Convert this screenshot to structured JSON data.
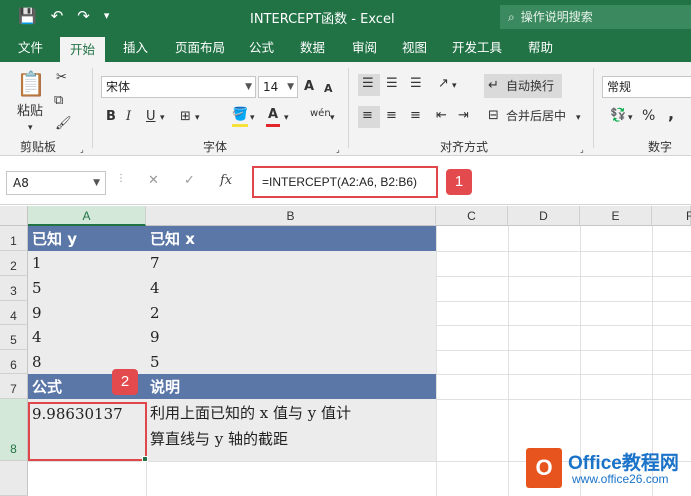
{
  "title_bar": {
    "title": "INTERCEPT函数  -  Excel",
    "search_placeholder": "操作说明搜索",
    "qat": {
      "save": "💾",
      "undo": "↶",
      "redo": "↷",
      "customize": "▾"
    }
  },
  "tabs": [
    "文件",
    "开始",
    "插入",
    "页面布局",
    "公式",
    "数据",
    "审阅",
    "视图",
    "开发工具",
    "帮助"
  ],
  "active_tab": "开始",
  "ribbon": {
    "clipboard": {
      "paste_label": "粘贴",
      "group_label": "剪贴板"
    },
    "font": {
      "font_name": "宋体",
      "font_size": "14",
      "group_label": "字体",
      "bold": "B",
      "italic": "I",
      "underline": "U",
      "grow": "A",
      "shrink": "A",
      "font_color": "A",
      "wen": "wén"
    },
    "alignment": {
      "wrap_text": "自动换行",
      "merge_center": "合并后居中",
      "group_label": "对齐方式"
    },
    "number": {
      "format": "常规",
      "percent": "%",
      "comma": ",",
      "group_label": "数字"
    }
  },
  "formula_bar": {
    "name_box": "A8",
    "cancel": "✕",
    "enter": "✓",
    "fx": "fx",
    "formula": "=INTERCEPT(A2:A6, B2:B6)"
  },
  "callouts": {
    "one": "1",
    "two": "2"
  },
  "grid": {
    "columns": [
      "A",
      "B",
      "C",
      "D",
      "E",
      "F"
    ],
    "rows": [
      "1",
      "2",
      "3",
      "4",
      "5",
      "6",
      "7",
      "8"
    ],
    "cells": {
      "A1": "已知 y",
      "B1": "已知 x",
      "A2": "1",
      "B2": "7",
      "A3": "5",
      "B3": "4",
      "A4": "9",
      "B4": "2",
      "A5": "4",
      "B5": "9",
      "A6": "8",
      "B6": "5",
      "A7": "公式",
      "B7": "说明",
      "A8": "9.98630137",
      "B8_line1": "利用上面已知的 x 值与 y 值计",
      "B8_line2": "算直线与 y 轴的截距"
    }
  },
  "watermark": {
    "logo_letter": "O",
    "line1": "Office教程网",
    "line2": "www.office26.com"
  }
}
